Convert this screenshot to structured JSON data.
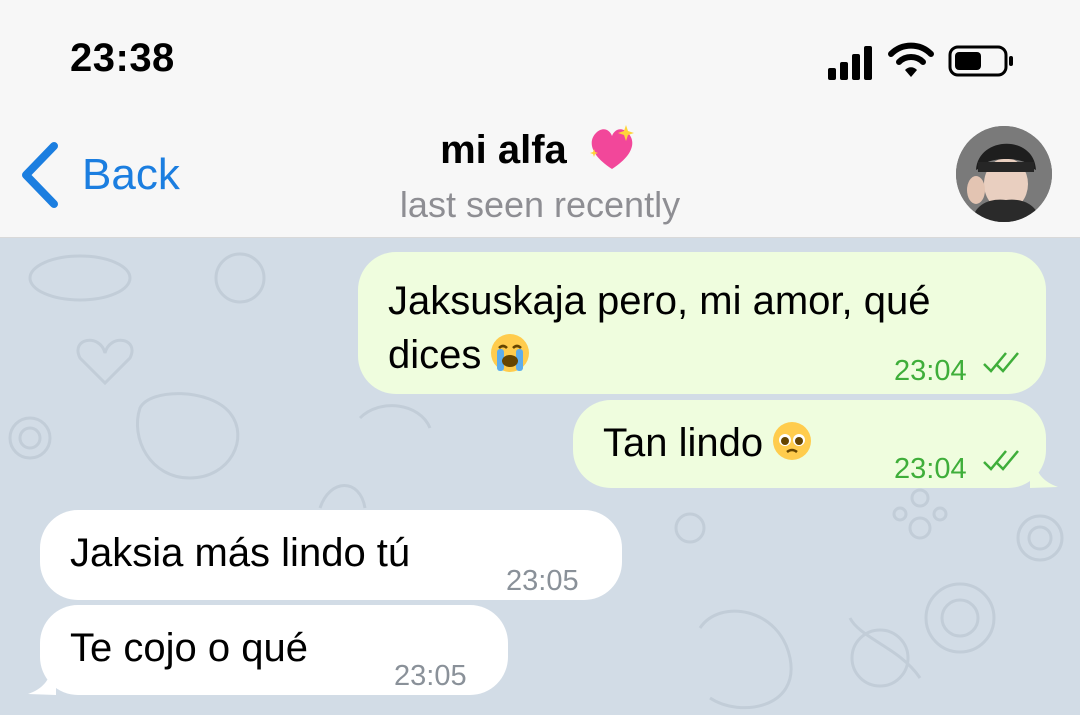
{
  "status_bar": {
    "time": "23:38",
    "icons": [
      "signal-icon",
      "wifi-icon",
      "battery-icon"
    ]
  },
  "header": {
    "back_label": "Back",
    "title": "mi alfa",
    "title_emoji": "sparkling-heart-emoji",
    "subtitle": "last seen recently"
  },
  "messages": [
    {
      "direction": "outgoing",
      "text_line1": "Jaksuskaja pero, mi amor, qué",
      "text_line2": "dices",
      "emoji": "loudly-crying-face-emoji",
      "time": "23:04",
      "status": "read"
    },
    {
      "direction": "outgoing",
      "text": "Tan lindo",
      "emoji": "pleading-face-emoji",
      "time": "23:04",
      "status": "read"
    },
    {
      "direction": "incoming",
      "text": "Jaksia más lindo tú",
      "time": "23:05"
    },
    {
      "direction": "incoming",
      "text": "Te cojo o qué",
      "time": "23:05"
    }
  ],
  "colors": {
    "accent": "#1b7ee0",
    "outgoing_bubble": "#effdde",
    "outgoing_time": "#3fae3a",
    "chat_background": "#d2dce6"
  }
}
